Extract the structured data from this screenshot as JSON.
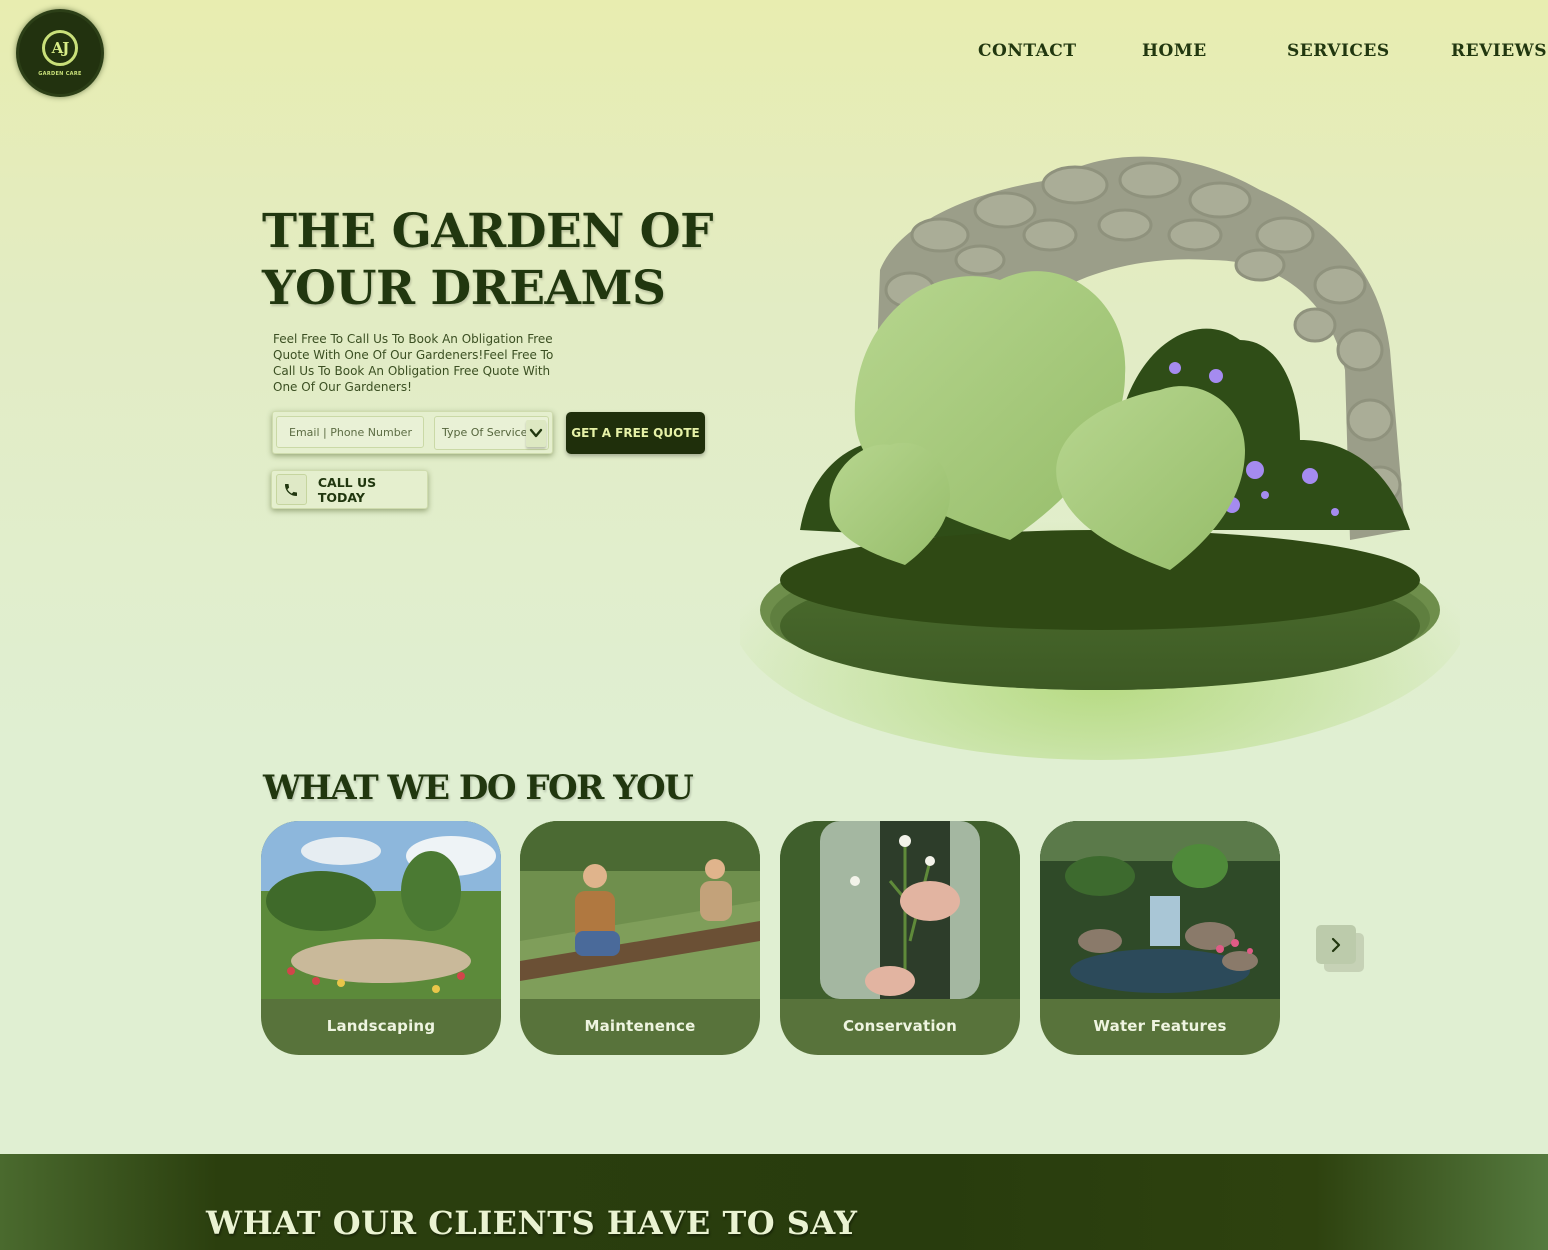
{
  "header": {
    "logo": {
      "monogram": "AJ",
      "caption": "GARDEN CARE"
    },
    "nav": [
      {
        "label": "CONTACT"
      },
      {
        "label": "HOME"
      },
      {
        "label": "SERVICES"
      },
      {
        "label": "REVIEWS"
      }
    ]
  },
  "hero": {
    "title_line1": "THE GARDEN OF",
    "title_line2": "YOUR DREAMS",
    "description": "Feel Free To Call Us To Book An Obligation Free Quote With One Of Our Gardeners!Feel Free To Call Us To Book An Obligation Free Quote With One Of Our Gardeners!",
    "contact_placeholder": "Email | Phone Number",
    "service_select": "Type Of Service",
    "quote_button": "GET A FREE QUOTE",
    "call_button": "CALL US TODAY"
  },
  "services": {
    "title": "WHAT WE DO FOR YOU",
    "cards": [
      {
        "label": "Landscaping"
      },
      {
        "label": "Maintenence"
      },
      {
        "label": "Conservation"
      },
      {
        "label": "Water Features"
      }
    ]
  },
  "testimonials": {
    "title": "WHAT OUR CLIENTS HAVE TO SAY"
  },
  "icons": {
    "phone": "phone-icon",
    "chevron_down": "chevron-down-icon",
    "chevron_right": "chevron-right-icon"
  },
  "colors": {
    "dark_green": "#1f2f0b",
    "card_green": "#58733b",
    "accent_lime": "#e6f2a7",
    "background_top": "#e8edb0",
    "background_bottom": "#e0efd2"
  }
}
